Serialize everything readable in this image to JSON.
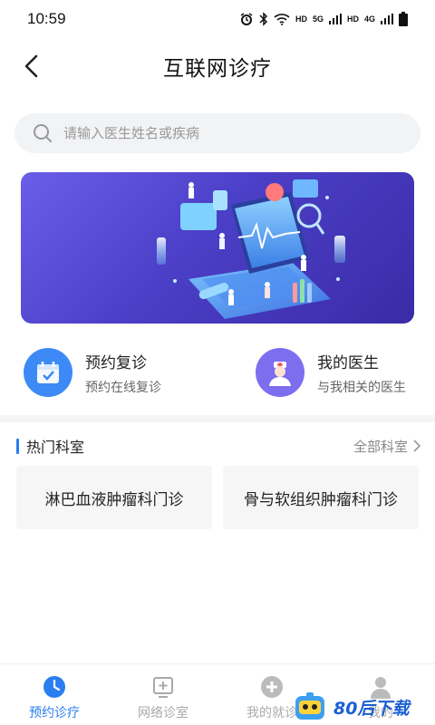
{
  "status_bar": {
    "time": "10:59",
    "net_labels": [
      "HD",
      "5G",
      "HD",
      "4G"
    ]
  },
  "nav": {
    "title": "互联网诊疗"
  },
  "search": {
    "placeholder": "请输入医生姓名或疾病",
    "value": ""
  },
  "quick_actions": [
    {
      "title": "预约复诊",
      "subtitle": "预约在线复诊",
      "icon": "calendar-check-icon",
      "color": "#3d8af7"
    },
    {
      "title": "我的医生",
      "subtitle": "与我相关的医生",
      "icon": "doctor-avatar-icon",
      "color": "#7d6ef0"
    }
  ],
  "section": {
    "title": "热门科室",
    "more_label": "全部科室"
  },
  "departments": [
    "淋巴血液肿瘤科门诊",
    "骨与软组织肿瘤科门诊"
  ],
  "tabs": [
    {
      "label": "预约诊疗",
      "icon": "clock-icon",
      "active": true
    },
    {
      "label": "网络诊室",
      "icon": "clinic-plus-icon",
      "active": false
    },
    {
      "label": "我的就诊",
      "icon": "medical-cross-icon",
      "active": false
    },
    {
      "label": "我的",
      "icon": "person-icon",
      "active": false
    }
  ],
  "watermark": {
    "text": "80后下载"
  },
  "colors": {
    "accent": "#2a7ef0",
    "banner": "#4b3fc7",
    "tab_inactive": "#aaaaaa"
  }
}
